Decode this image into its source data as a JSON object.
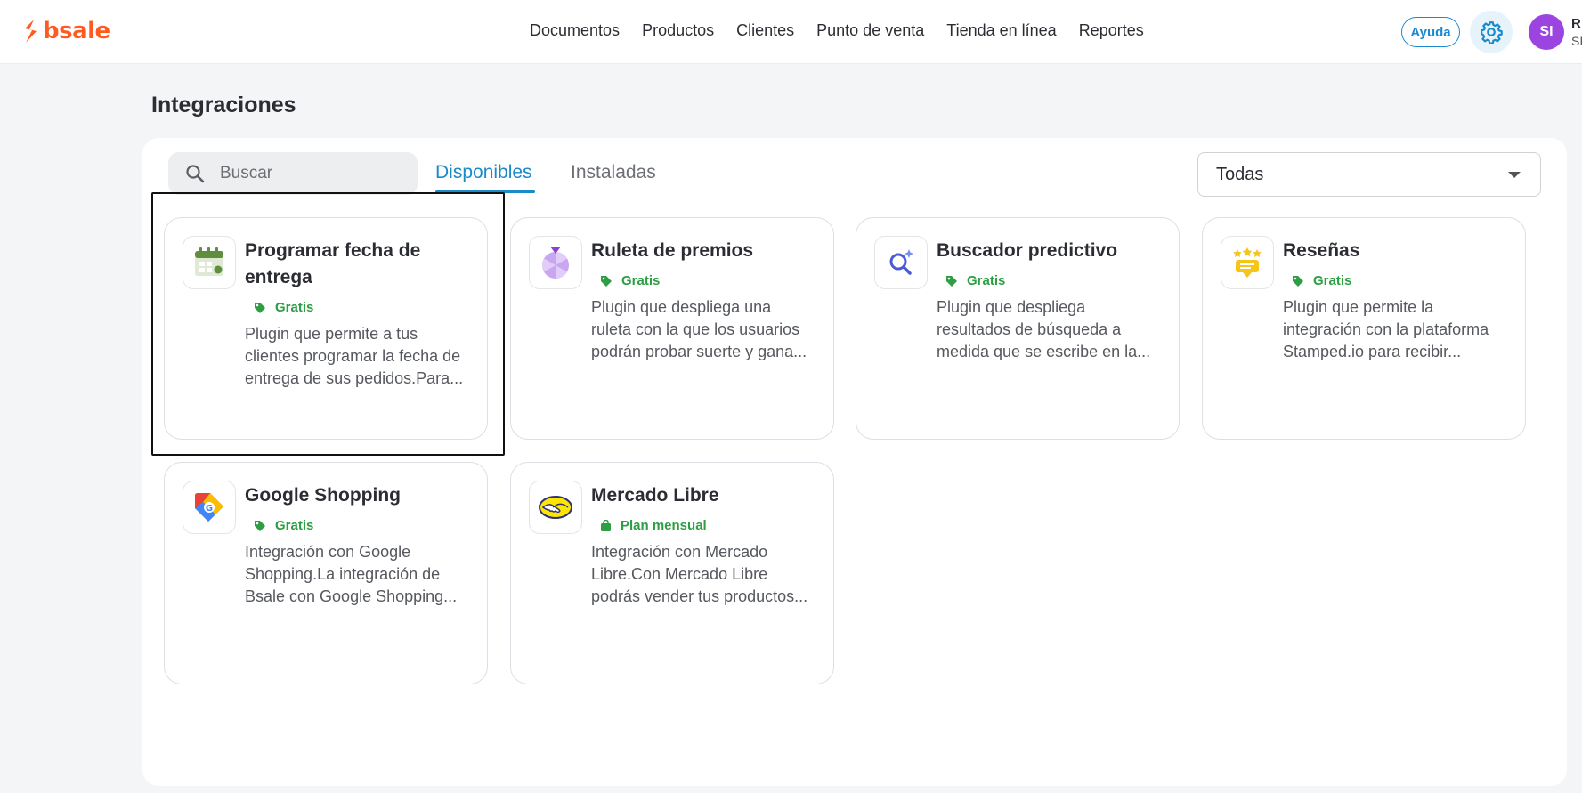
{
  "brand": {
    "name": "bsale",
    "color": "#ff5a1f"
  },
  "nav": [
    "Documentos",
    "Productos",
    "Clientes",
    "Punto de venta",
    "Tienda en línea",
    "Reportes"
  ],
  "header": {
    "help_label": "Ayuda",
    "avatar_initials": "SI",
    "user_name": "R",
    "user_role": "SI"
  },
  "page": {
    "title": "Integraciones"
  },
  "search": {
    "placeholder": "Buscar"
  },
  "tabs": {
    "active": "Disponibles",
    "inactive": "Instaladas"
  },
  "filter": {
    "selected": "Todas"
  },
  "accent": "#1a8ac9",
  "plugins": [
    {
      "icon": "calendar-icon",
      "title_lines": [
        "Programar fecha de",
        "entrega"
      ],
      "badge": "Gratis",
      "badge_icon": "tag-icon",
      "desc": [
        "Plugin que permite a tus",
        "clientes programar la fecha de",
        "entrega de sus pedidos.Para..."
      ]
    },
    {
      "icon": "prize-wheel-icon",
      "title_lines": [
        "Ruleta de premios"
      ],
      "badge": "Gratis",
      "badge_icon": "tag-icon",
      "desc": [
        "Plugin que despliega una",
        "ruleta con la que los usuarios",
        "podrán probar suerte y gana..."
      ]
    },
    {
      "icon": "predictive-search-icon",
      "title_lines": [
        "Buscador predictivo"
      ],
      "badge": "Gratis",
      "badge_icon": "tag-icon",
      "desc": [
        "Plugin que despliega",
        "resultados de búsqueda a",
        "medida que se escribe en la..."
      ]
    },
    {
      "icon": "reviews-stars-icon",
      "title_lines": [
        "Reseñas"
      ],
      "badge": "Gratis",
      "badge_icon": "tag-icon",
      "desc": [
        "Plugin que permite la",
        "integración con la plataforma",
        "Stamped.io para recibir..."
      ]
    },
    {
      "icon": "google-shopping-icon",
      "title_lines": [
        "Google Shopping"
      ],
      "badge": "Gratis",
      "badge_icon": "tag-icon",
      "desc": [
        "Integración con Google",
        "Shopping.La integración de",
        "Bsale con Google Shopping..."
      ]
    },
    {
      "icon": "mercado-libre-icon",
      "title_lines": [
        "Mercado Libre"
      ],
      "badge": "Plan mensual",
      "badge_icon": "shopping-bag-icon",
      "desc": [
        "Integración con Mercado",
        "Libre.Con Mercado Libre",
        "podrás vender tus productos..."
      ]
    }
  ]
}
